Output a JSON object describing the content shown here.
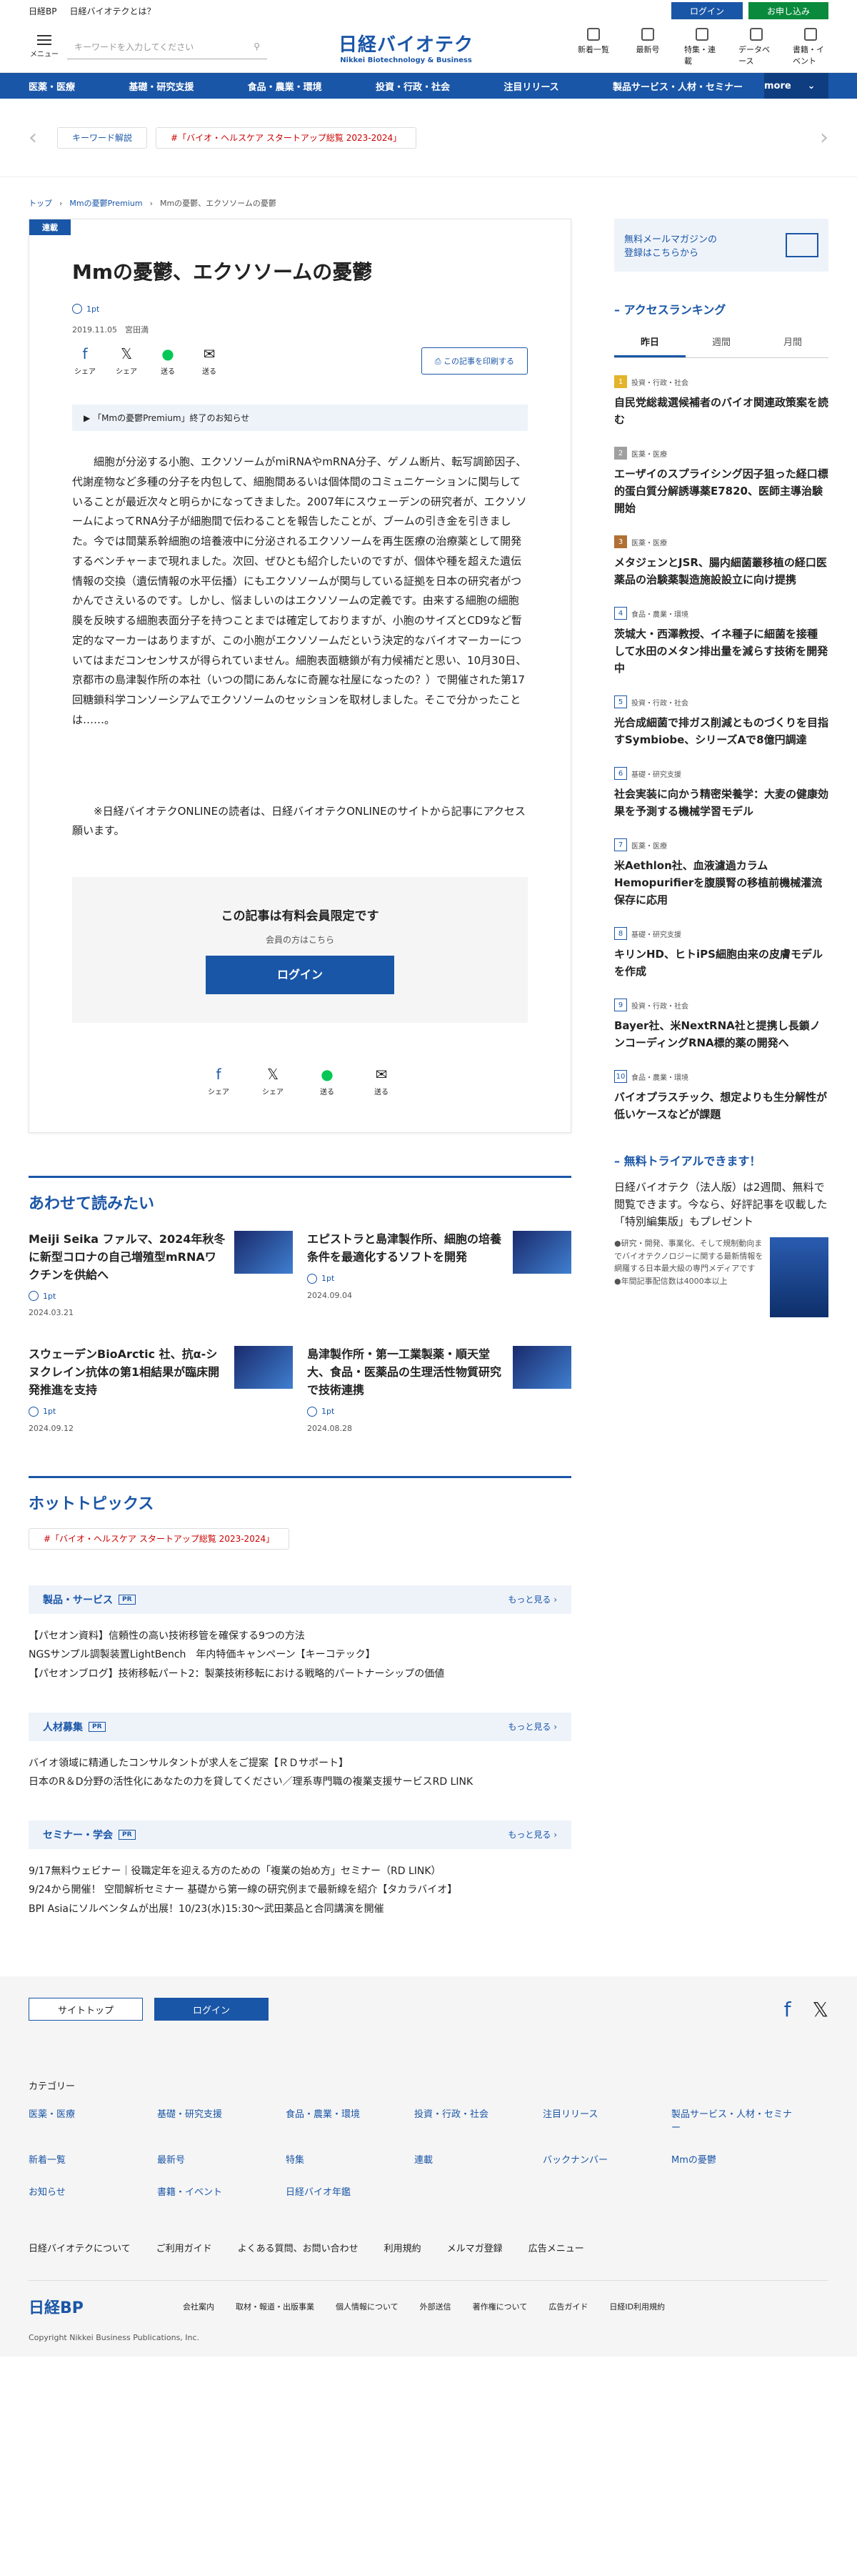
{
  "topbar": {
    "brand": "日経BP",
    "about": "日経バイオテクとは？",
    "login": "ログイン",
    "apply": "お申し込み"
  },
  "header": {
    "menu": "メニュー",
    "search_placeholder": "キーワードを入力してください",
    "logo_main": "日経バイオテク",
    "logo_sub": "Nikkei Biotechnology & Business",
    "icons": [
      {
        "label": "新着一覧"
      },
      {
        "label": "最新号"
      },
      {
        "label": "特集・連載"
      },
      {
        "label": "データベース"
      },
      {
        "label": "書籍・イベント"
      }
    ]
  },
  "nav": {
    "items": [
      "医薬・医療",
      "基礎・研究支援",
      "食品・農業・環境",
      "投資・行政・社会",
      "注目リリース",
      "製品サービス・人材・セミナー"
    ],
    "more": "more"
  },
  "keywords": {
    "a": "キーワード解説",
    "b": "#「バイオ・ヘルスケア スタートアップ総覧 2023-2024」"
  },
  "breadcrumb": {
    "home": "トップ",
    "series": "Mmの憂鬱Premium",
    "current": "Mmの憂鬱、エクソソームの憂鬱"
  },
  "article": {
    "tag": "連載",
    "title": "Mmの憂鬱、エクソソームの憂鬱",
    "points": "1pt",
    "date": "2019.11.05　宮田満",
    "share": [
      "シェア",
      "シェア",
      "送る",
      "送る"
    ],
    "print": "この記事を印刷する",
    "notice": "「Mmの憂鬱Premium」終了のお知らせ",
    "body": "　細胞が分泌する小胞、エクソソームがmiRNAやmRNA分子、ゲノム断片、転写調節因子、代謝産物など多種の分子を内包して、細胞間あるいは個体間のコミュニケーションに関与していることが最近次々と明らかになってきました。2007年にスウェーデンの研究者が、エクソソームによってRNA分子が細胞間で伝わることを報告したことが、ブームの引き金を引きました。今では間葉系幹細胞の培養液中に分泌されるエクソソームを再生医療の治療薬として開発するベンチャーまで現れました。次回、ぜひとも紹介したいのですが、個体や種を超えた遺伝情報の交換（遺伝情報の水平伝播）にもエクソソームが関与している証拠を日本の研究者がつかんでさえいるのです。しかし、悩ましいのはエクソソームの定義です。由来する細胞の細胞膜を反映する細胞表面分子を持つことまでは確定しておりますが、小胞のサイズとCD9など暫定的なマーカーはありますが、この小胞がエクソソームだという決定的なバイオマーカーについてはまだコンセンサスが得られていません。細胞表面糖鎖が有力候補だと思い、10月30日、京都市の島津製作所の本社（いつの間にあんなに奇麗な社屋になったの？）で開催された第17回糖鎖科学コンソーシアムでエクソソームのセッションを取材しました。そこで分かったことは……。",
    "note": "　※日経バイオテクONLINEの読者は、日経バイオテクONLINEのサイトから記事にアクセス願います。",
    "locked_title": "この記事は有料会員限定です",
    "locked_sub": "会員の方はこちら",
    "login": "ログイン"
  },
  "related": {
    "title": "あわせて読みたい",
    "items": [
      {
        "title": "Meiji Seika ファルマ、2024年秋冬に新型コロナの自己増殖型mRNAワクチンを供給へ",
        "pt": "1pt",
        "date": "2024.03.21"
      },
      {
        "title": "エピストラと島津製作所、細胞の培養条件を最適化するソフトを開発",
        "pt": "1pt",
        "date": "2024.09.04"
      },
      {
        "title": "スウェーデンBioArctic 社、抗α-シヌクレイン抗体の第1相結果が臨床開発推進を支持",
        "pt": "1pt",
        "date": "2024.09.12"
      },
      {
        "title": "島津製作所・第一工業製薬・順天堂大、食品・医薬品の生理活性物質研究で技術連携",
        "pt": "1pt",
        "date": "2024.08.28"
      }
    ]
  },
  "hot": {
    "title": "ホットトピックス",
    "chip": "#「バイオ・ヘルスケア スタートアップ総覧 2023-2024」"
  },
  "pr": [
    {
      "title": "製品・サービス",
      "badge": "PR",
      "more": "もっと見る",
      "items": [
        "【パセオン資料】信頼性の高い技術移管を確保する9つの方法",
        "NGSサンプル調製装置LightBench　年内特価キャンペーン【キーコテック】",
        "【パセオンブログ】技術移転パート2：製薬技術移転における戦略的パートナーシップの価値"
      ]
    },
    {
      "title": "人材募集",
      "badge": "PR",
      "more": "もっと見る",
      "items": [
        "バイオ領域に精通したコンサルタントが求人をご提案【ＲＤサポート】",
        "日本のR＆D分野の活性化にあなたの力を貸してください／理系専門職の複業支援サービスRD LINK"
      ]
    },
    {
      "title": "セミナー・学会",
      "badge": "PR",
      "more": "もっと見る",
      "items": [
        "9/17無料ウェビナー｜役職定年を迎える方のための「複業の始め方」セミナー（RD LINK）",
        "9/24から開催！ 空間解析セミナー 基礎から第一線の研究例まで最新線を紹介【タカラバイオ】",
        "BPI Asiaにソルベンタムが出展！10/23(水)15:30～武田薬品と合同講演を開催"
      ]
    }
  ],
  "side": {
    "mail": "無料メールマガジンの\n登録はこちらから",
    "ranking_title": "アクセスランキング",
    "tabs": [
      "昨日",
      "週間",
      "月間"
    ],
    "ranking": [
      {
        "n": "1",
        "c": "投資・行政・社会",
        "t": "自民党総裁選候補者のバイオ関連政策案を読む"
      },
      {
        "n": "2",
        "c": "医薬・医療",
        "t": "エーザイのスプライシング因子狙った経口標的蛋白質分解誘導薬E7820、医師主導治験開始"
      },
      {
        "n": "3",
        "c": "医薬・医療",
        "t": "メタジェンとJSR、腸内細菌叢移植の経口医薬品の治験薬製造施設設立に向け提携"
      },
      {
        "n": "4",
        "c": "食品・農業・環境",
        "t": "茨城大・西澤教授、イネ種子に細菌を接種して水田のメタン排出量を減らす技術を開発中"
      },
      {
        "n": "5",
        "c": "投資・行政・社会",
        "t": "光合成細菌で排ガス削減とものづくりを目指すSymbiobe、シリーズAで8億円調達"
      },
      {
        "n": "6",
        "c": "基礎・研究支援",
        "t": "社会実装に向かう精密栄養学：大麦の健康効果を予測する機械学習モデル"
      },
      {
        "n": "7",
        "c": "医薬・医療",
        "t": "米Aethlon社、血液濾過カラムHemopurifierを腹膜腎の移植前機械灌流保存に応用"
      },
      {
        "n": "8",
        "c": "基礎・研究支援",
        "t": "キリンHD、ヒトiPS細胞由来の皮膚モデルを作成"
      },
      {
        "n": "9",
        "c": "投資・行政・社会",
        "t": "Bayer社、米NextRNA社と提携し長鎖ノンコーディングRNA標的薬の開発へ"
      },
      {
        "n": "10",
        "c": "食品・農業・環境",
        "t": "バイオプラスチック、想定よりも生分解性が低いケースなどが課題"
      }
    ],
    "trial_title": "無料トライアルできます！",
    "trial": "日経バイオテク（法人版）は2週間、無料で閲覧できます。今なら、好評記事を収載した「特別編集版」もプレゼント",
    "trial_sub": "●研究・開発、事業化、そして規制動向までバイオテクノロジーに関する最新情報を網羅する日本最大級の専門メディアです\n●年間記事配信数は4000本以上"
  },
  "footer": {
    "top": "サイトトップ",
    "login": "ログイン",
    "cats_title": "カテゴリー",
    "cats": [
      "医薬・医療",
      "基礎・研究支援",
      "食品・農業・環境",
      "投資・行政・社会",
      "注目リリース",
      "製品サービス・人材・セミナー",
      "新着一覧",
      "最新号",
      "特集",
      "連載",
      "バックナンバー",
      "Mmの憂鬱",
      "お知らせ",
      "書籍・イベント",
      "日経バイオ年鑑"
    ],
    "links": [
      "日経バイオテクについて",
      "ご利用ガイド",
      "よくある質問、お問い合わせ",
      "利用規約",
      "メルマガ登録",
      "広告メニュー"
    ],
    "corp": "日経BP",
    "corp_links": [
      "会社案内",
      "取材・報道・出版事業",
      "個人情報について",
      "外部送信",
      "著作権について",
      "広告ガイド",
      "日経ID利用規約"
    ],
    "copy": "Copyright Nikkei Business Publications, Inc."
  }
}
